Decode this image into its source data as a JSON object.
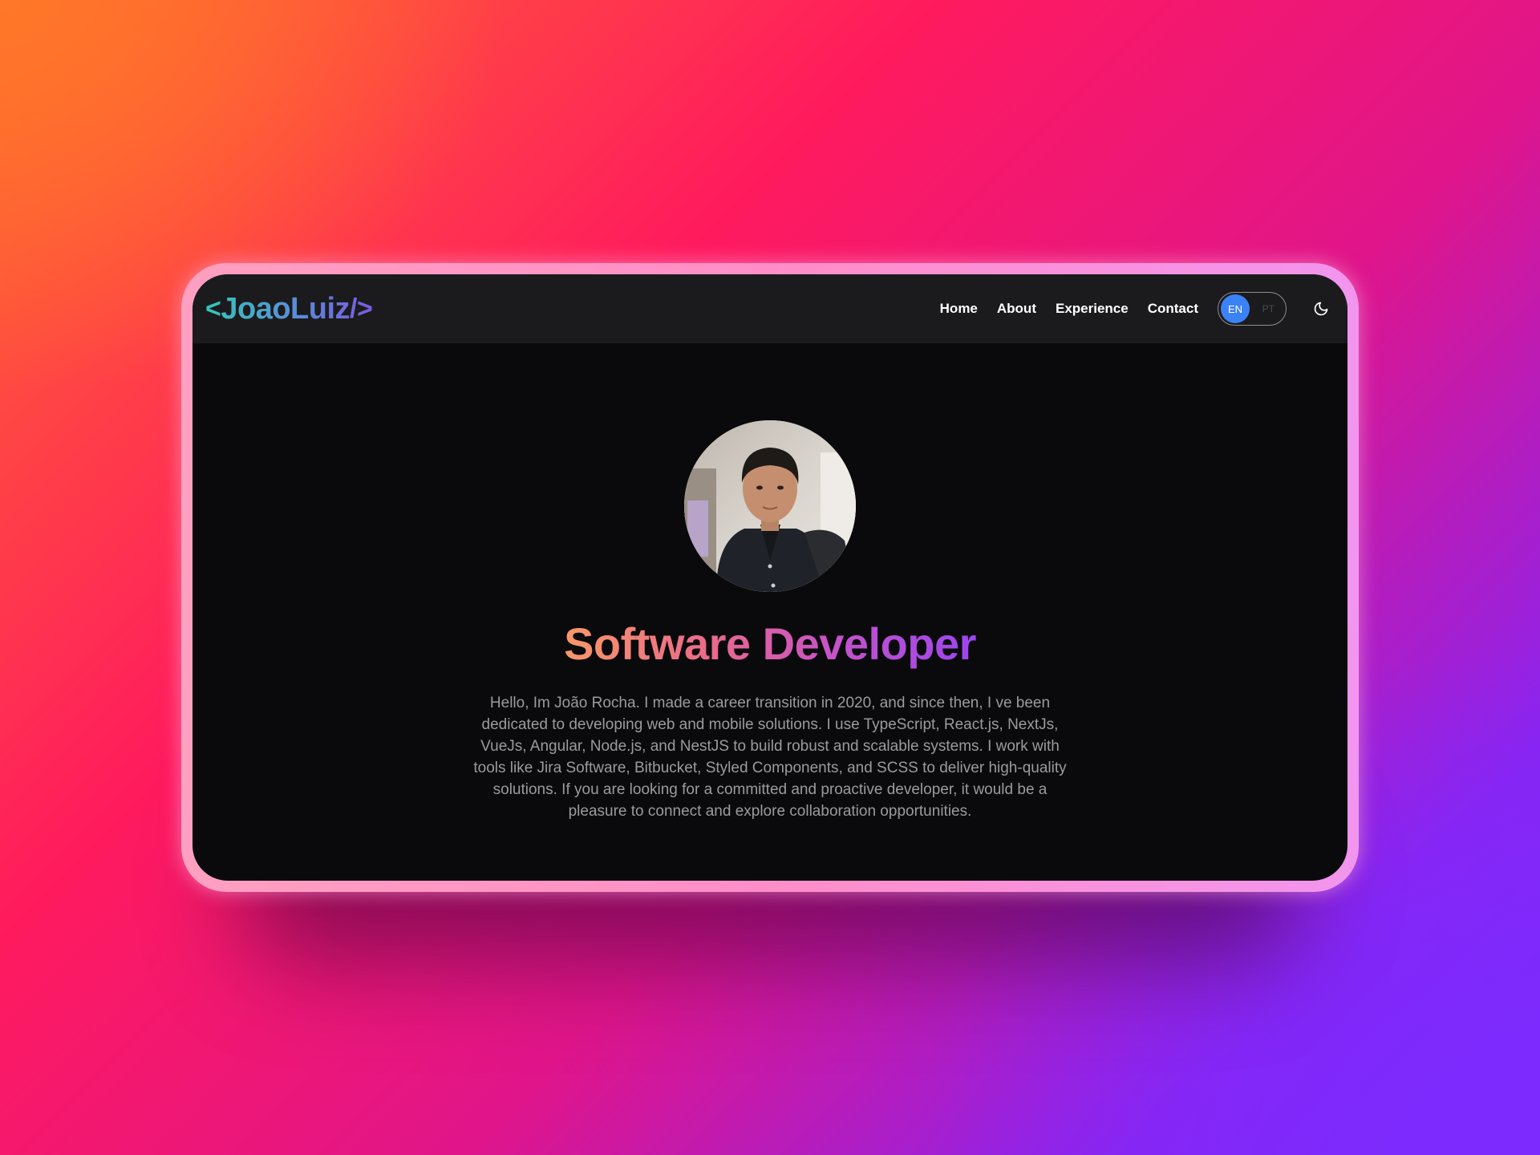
{
  "navbar": {
    "logo": {
      "open": "<",
      "name": "JoaoLuiz",
      "close": "/>"
    },
    "links": [
      {
        "label": "Home"
      },
      {
        "label": "About"
      },
      {
        "label": "Experience"
      },
      {
        "label": "Contact"
      }
    ],
    "language": {
      "active": "EN",
      "inactive": "PT"
    },
    "theme_icon": "moon-icon"
  },
  "hero": {
    "avatar_icon": "profile-photo",
    "title": "Software Developer",
    "bio": "Hello, Im João Rocha. I made a career transition in 2020, and since then, I ve been dedicated to developing web and mobile solutions. I use TypeScript, React.js, NextJs, VueJs, Angular, Node.js, and NestJS to build robust and scalable systems. I work with tools like Jira Software, Bitbucket, Styled Components, and SCSS to deliver high-quality solutions. If you are looking for a committed and proactive developer, it would be a pleasure to connect and explore collaboration opportunities."
  },
  "colors": {
    "accent_blue": "#3b82f6",
    "navbar_bg": "#1b1b1d",
    "page_bg": "#0a0a0c"
  }
}
